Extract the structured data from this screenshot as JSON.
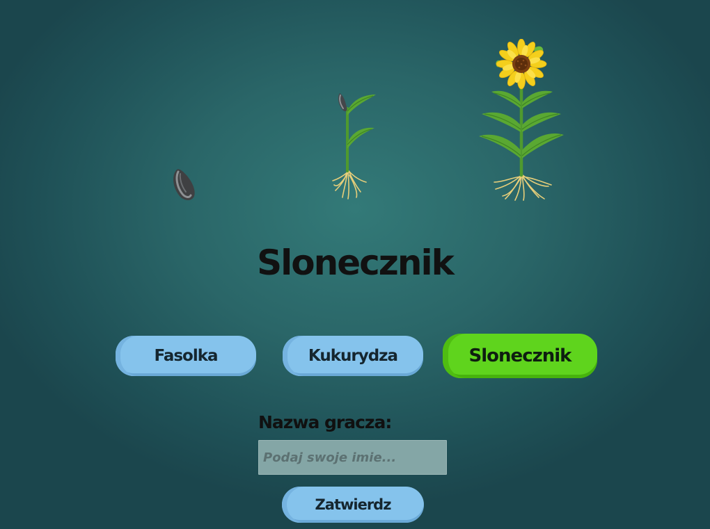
{
  "title": "Slonecznik",
  "growth_stages": [
    {
      "icon": "sunflower-seed-icon"
    },
    {
      "icon": "sunflower-sprout-icon"
    },
    {
      "icon": "sunflower-bloom-icon"
    }
  ],
  "plant_options": [
    {
      "label": "Fasolka",
      "selected": false
    },
    {
      "label": "Kukurydza",
      "selected": false
    },
    {
      "label": "Slonecznik",
      "selected": true
    }
  ],
  "player": {
    "label": "Nazwa gracza:",
    "value": "",
    "placeholder": "Podaj swoje imie..."
  },
  "submit_label": "Zatwierdz",
  "colors": {
    "background": "#2a6668",
    "button_default": "#85c3ec",
    "button_selected": "#5fd41d",
    "title_text": "#111111",
    "input_background": "#84a6a6"
  }
}
